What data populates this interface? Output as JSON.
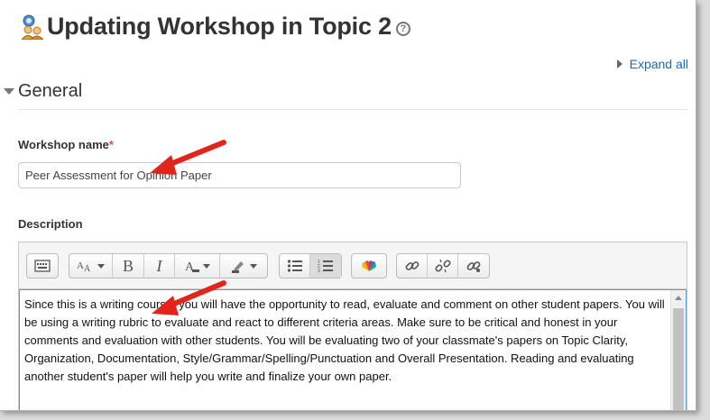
{
  "header": {
    "title": "Updating Workshop in Topic 2",
    "help_glyph": "?",
    "expand_all": "Expand all"
  },
  "general": {
    "section_label": "General"
  },
  "form": {
    "name_label": "Workshop name",
    "required_mark": "*",
    "name_value": "Peer Assessment for Opinion Paper",
    "description_label": "Description",
    "description_text": "Since this is a writing course, you will have the opportunity to read, evaluate and comment on other student papers.  You will be using a writing rubric to evaluate and react to different criteria areas.  Make sure to be critical and honest in your comments and evaluation with other students.  You will be evaluating two of your classmate's papers on Topic Clarity, Organization, Documentation, Style/Grammar/Spelling/Punctuation and Overall Presentation.  Reading and evaluating another student's paper will help you write and finalize your own paper."
  },
  "toolbar": {
    "bold_glyph": "B",
    "italic_glyph": "I",
    "buttons": [
      "show-more-icon",
      "font-style-icon",
      "bold-icon",
      "italic-icon",
      "text-color-icon",
      "highlight-icon",
      "bullet-list-icon",
      "numbered-list-icon",
      "media-icon",
      "link-icon",
      "unlink-icon",
      "autolink-icon"
    ]
  },
  "colors": {
    "link": "#0f6fc5",
    "required": "#d9534f",
    "annotation_arrow": "#e3241b",
    "editor_focus": "#6699cc"
  }
}
